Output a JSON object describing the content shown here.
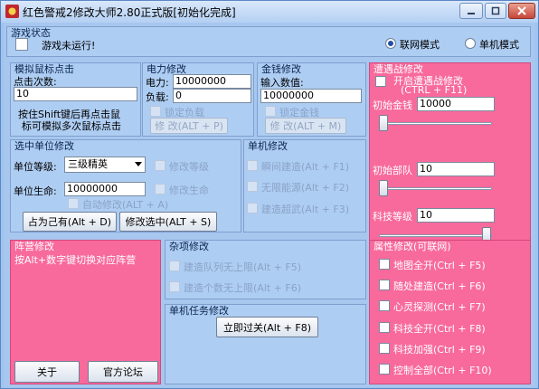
{
  "window": {
    "title": "红色警戒2修改大师2.80正式版[初始化完成]"
  },
  "game_status": {
    "title": "游戏状态",
    "status_text": "游戏未运行!",
    "mode_online": "联网模式",
    "mode_single": "单机模式",
    "selected_mode": "online"
  },
  "mouse_sim": {
    "title": "模拟鼠标点击",
    "count_label": "点击次数:",
    "count_value": "10",
    "hint_line1": "按住Shift键后再点击鼠",
    "hint_line2": "标可模拟多次鼠标点击"
  },
  "power": {
    "title": "电力修改",
    "power_label": "电力:",
    "power_value": "10000000",
    "load_label": "负载:",
    "load_value": "0",
    "lock_label": "锁定负载",
    "modify_button": "修 改(ALT + P)"
  },
  "money": {
    "title": "金钱修改",
    "input_label": "输入数值:",
    "input_value": "10000000",
    "lock_label": "锁定金钱",
    "modify_button": "修 改(ALT + M)"
  },
  "encounter": {
    "title": "遭遇战修改",
    "enable_label": "开启遭遇战修改",
    "enable_hotkey": "(CTRL + F11)",
    "money_label": "初始金钱",
    "money_value": "10000",
    "money_slider": 0.0,
    "units_label": "初始部队",
    "units_value": "10",
    "units_slider": 0.0,
    "tech_label": "科技等级",
    "tech_value": "10",
    "tech_slider": 1.0
  },
  "unit_edit": {
    "title": "选中单位修改",
    "level_label": "单位等级:",
    "level_value": "三级精英",
    "level_check": "修改等级",
    "life_label": "单位生命:",
    "life_value": "10000000",
    "life_check": "修改生命",
    "auto_check": "自动修改(ALT + A)",
    "own_button": "占为己有(Alt + D)",
    "modify_button": "修改选中(ALT + S)"
  },
  "single": {
    "title": "单机修改",
    "items": [
      "瞬间建造(Alt + F1)",
      "无限能源(Alt + F2)",
      "建造超武(Alt + F3)"
    ]
  },
  "camp": {
    "title": "阵营修改",
    "hint": "按Alt+数字键切换对应阵营"
  },
  "misc": {
    "title": "杂项修改",
    "items": [
      "建造队列无上限(Alt + F5)",
      "建造个数无上限(Alt + F6)"
    ]
  },
  "task": {
    "title": "单机任务修改",
    "pass_button": "立即过关(Alt + F8)"
  },
  "attrs": {
    "title": "属性修改(可联网)",
    "items": [
      "地图全开(Ctrl + F5)",
      "随处建造(Ctrl + F6)",
      "心灵探测(Ctrl + F7)",
      "科技全开(Ctrl + F8)",
      "科技加强(Ctrl + F9)",
      "控制全部(Ctrl + F10)"
    ]
  },
  "footer": {
    "about_button": "关于",
    "forum_button": "官方论坛"
  },
  "colors": {
    "window_bg": "#a7c7ef",
    "pink_panel": "#f86a9c"
  }
}
